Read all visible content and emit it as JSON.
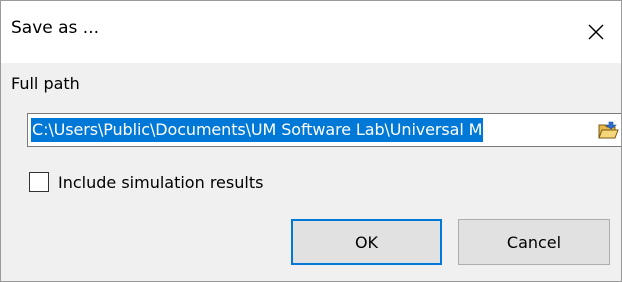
{
  "window": {
    "title": "Save as ...",
    "close_icon": "close-icon"
  },
  "form": {
    "full_path_label": "Full path",
    "full_path_value": "C:\\Users\\Public\\Documents\\UM Software Lab\\Universal M",
    "browse_icon": "folder-open-icon",
    "include_results_label": "Include simulation results",
    "include_results_checked": false
  },
  "buttons": {
    "ok_label": "OK",
    "cancel_label": "Cancel"
  },
  "colors": {
    "selection": "#0078d7",
    "default_button_border": "#0078d7"
  }
}
